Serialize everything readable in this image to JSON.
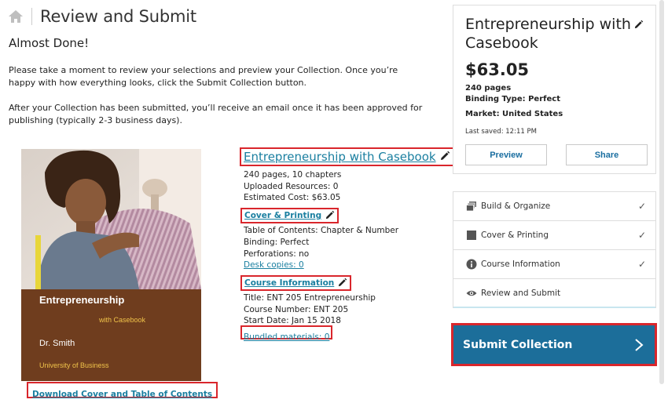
{
  "header": {
    "title": "Review and Submit"
  },
  "intro": {
    "heading": "Almost Done!",
    "paragraph1": "Please take a moment to review your selections and preview your Collection. Once you’re happy with how everything looks, click the Submit Collection button.",
    "paragraph2": "After your Collection has been submitted, you’ll receive an email once it has been approved for publishing (typically 2-3 business days)."
  },
  "cover": {
    "title": "Entrepreneurship",
    "subtitle": "with Casebook",
    "author": "Dr. Smith",
    "school": "University of Business",
    "download_label": "Download Cover and Table of Contents"
  },
  "details": {
    "title": "Entrepreneurship with Casebook",
    "pages": "240 pages, 10 chapters",
    "uploaded": "Uploaded Resources: 0",
    "cost": "Estimated Cost: $63.05",
    "cover_printing": {
      "heading": "Cover & Printing",
      "toc": "Table of Contents: Chapter & Number",
      "binding": "Binding: Perfect",
      "perforations": "Perforations: no",
      "desk_copies": "Desk copies: 0"
    },
    "course_info": {
      "heading": "Course Information",
      "title": "Title: ENT 205 Entrepreneurship",
      "number": "Course Number: ENT 205",
      "start": "Start Date: Jan 15 2018",
      "bundled": "Bundled materials: 0"
    }
  },
  "summary": {
    "title": "Entrepreneurship with Casebook",
    "price": "$63.05",
    "pages": "240 pages",
    "binding": "Binding Type: Perfect",
    "market": "Market: United States",
    "saved": "Last saved: 12:11 PM",
    "preview_label": "Preview",
    "share_label": "Share"
  },
  "steps": [
    {
      "label": "Build & Organize",
      "icon": "layers-icon",
      "done": "✓"
    },
    {
      "label": "Cover & Printing",
      "icon": "book-icon",
      "done": "✓"
    },
    {
      "label": "Course Information",
      "icon": "info-icon",
      "done": "✓"
    },
    {
      "label": "Review and Submit",
      "icon": "eye-icon",
      "done": ""
    }
  ],
  "submit": {
    "label": "Submit Collection"
  },
  "colors": {
    "link": "#1a7fa0",
    "primary": "#1c6e9a",
    "highlight": "#d9262c",
    "cover_band": "#6f3d1e"
  }
}
